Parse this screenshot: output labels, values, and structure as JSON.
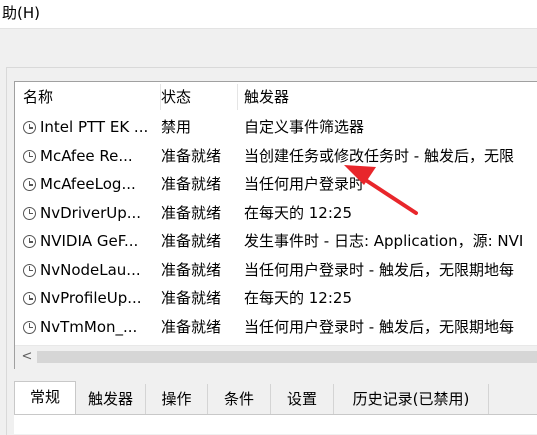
{
  "menubar": {
    "help_label": "助(H)"
  },
  "table": {
    "headers": {
      "name": "名称",
      "status": "状态",
      "trigger": "触发器"
    },
    "rows": [
      {
        "name": "Intel PTT EK ...",
        "status": "禁用",
        "trigger": "自定义事件筛选器"
      },
      {
        "name": "McAfee Re...",
        "status": "准备就绪",
        "trigger": "当创建任务或修改任务时 - 触发后，无限"
      },
      {
        "name": "McAfeeLog...",
        "status": "准备就绪",
        "trigger": "当任何用户登录时"
      },
      {
        "name": "NvDriverUp...",
        "status": "准备就绪",
        "trigger": "在每天的 12:25"
      },
      {
        "name": "NVIDIA GeF...",
        "status": "准备就绪",
        "trigger": "发生事件时 - 日志: Application，源: NVI"
      },
      {
        "name": "NvNodeLau...",
        "status": "准备就绪",
        "trigger": "当任何用户登录时 - 触发后，无限期地每"
      },
      {
        "name": "NvProfileUp...",
        "status": "准备就绪",
        "trigger": "在每天的 12:25"
      },
      {
        "name": "NvTmMon_...",
        "status": "准备就绪",
        "trigger": "当任何用户登录时 - 触发后，无限期地每"
      }
    ]
  },
  "scrollbar": {
    "left_arrow": "<"
  },
  "tabs": [
    {
      "label": "常规",
      "active": true
    },
    {
      "label": "触发器",
      "active": false
    },
    {
      "label": "操作",
      "active": false
    },
    {
      "label": "条件",
      "active": false
    },
    {
      "label": "设置",
      "active": false
    },
    {
      "label": "历史记录(已禁用)",
      "active": false
    }
  ],
  "icons": {
    "task": "clock-icon"
  },
  "colors": {
    "annotation_arrow": "#e8262b"
  }
}
